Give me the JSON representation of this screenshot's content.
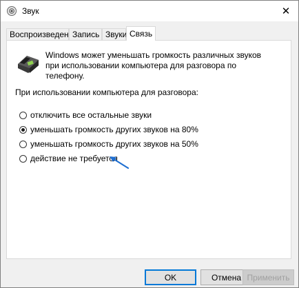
{
  "window": {
    "title": "Звук",
    "close_glyph": "✕"
  },
  "tabs": [
    {
      "label": "Воспроизведение"
    },
    {
      "label": "Запись"
    },
    {
      "label": "Звуки"
    },
    {
      "label": "Связь",
      "active": true
    }
  ],
  "comm": {
    "description": "Windows может уменьшать громкость различных звуков при использовании компьютера для разговора по телефону.",
    "group_label": "При использовании компьютера для разговора:",
    "options": [
      {
        "label": "отключить все остальные звуки",
        "checked": false
      },
      {
        "label": "уменьшать громкость других звуков на 80%",
        "checked": true
      },
      {
        "label": "уменьшать громкость других звуков на 50%",
        "checked": false
      },
      {
        "label": "действие не требуется",
        "checked": false
      }
    ]
  },
  "buttons": {
    "ok": "OK",
    "cancel": "Отмена",
    "apply": "Применить"
  },
  "colors": {
    "accent": "#0078d7",
    "arrow": "#1f6fd1"
  }
}
